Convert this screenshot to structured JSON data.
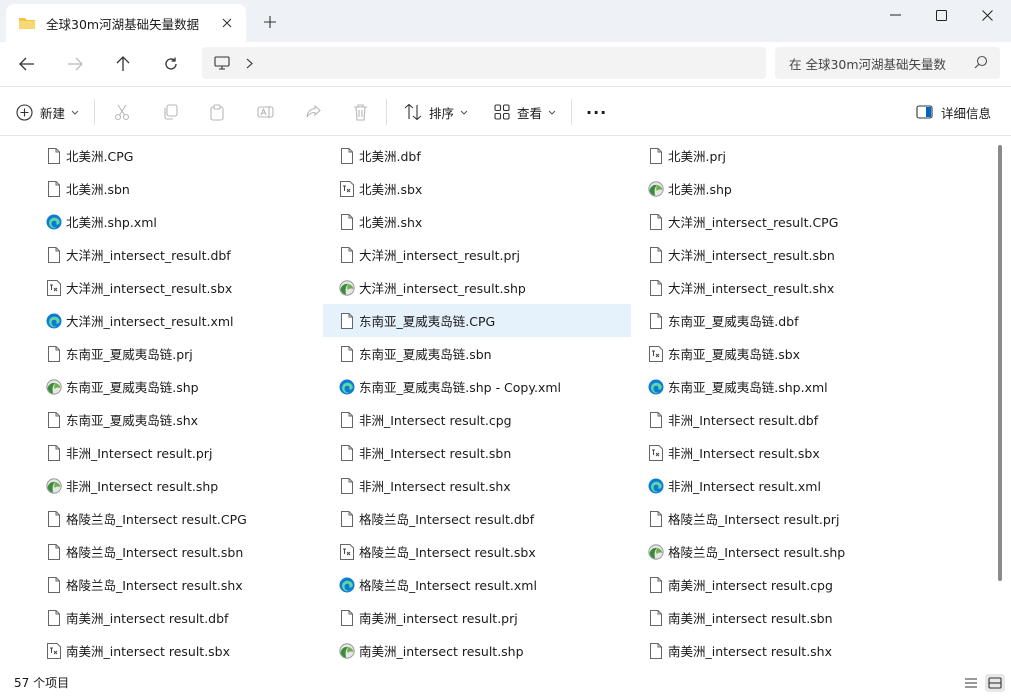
{
  "tab": {
    "title": "全球30m河湖基础矢量数据"
  },
  "window": {
    "minimize_icon": "minimize-icon",
    "maximize_icon": "maximize-icon",
    "close_icon": "close-icon"
  },
  "search": {
    "placeholder": "在 全球30m河湖基础矢量数"
  },
  "commands": {
    "new_label": "新建",
    "sort_label": "排序",
    "view_label": "查看",
    "more_label": "···",
    "details_label": "详细信息"
  },
  "files": [
    [
      {
        "name": "北美洲.CPG",
        "type": "doc"
      },
      {
        "name": "北美洲.dbf",
        "type": "doc"
      },
      {
        "name": "北美洲.prj",
        "type": "doc"
      }
    ],
    [
      {
        "name": "北美洲.sbn",
        "type": "doc"
      },
      {
        "name": "北美洲.sbx",
        "type": "sbx"
      },
      {
        "name": "北美洲.shp",
        "type": "shp"
      }
    ],
    [
      {
        "name": "北美洲.shp.xml",
        "type": "xml"
      },
      {
        "name": "北美洲.shx",
        "type": "doc"
      },
      {
        "name": "大洋洲_intersect_result.CPG",
        "type": "doc"
      }
    ],
    [
      {
        "name": "大洋洲_intersect_result.dbf",
        "type": "doc"
      },
      {
        "name": "大洋洲_intersect_result.prj",
        "type": "doc"
      },
      {
        "name": "大洋洲_intersect_result.sbn",
        "type": "doc"
      }
    ],
    [
      {
        "name": "大洋洲_intersect_result.sbx",
        "type": "sbx"
      },
      {
        "name": "大洋洲_intersect_result.shp",
        "type": "shp"
      },
      {
        "name": "大洋洲_intersect_result.shx",
        "type": "doc"
      }
    ],
    [
      {
        "name": "大洋洲_intersect_result.xml",
        "type": "xml"
      },
      {
        "name": "东南亚_夏威夷岛链.CPG",
        "type": "doc",
        "selected": true
      },
      {
        "name": "东南亚_夏威夷岛链.dbf",
        "type": "doc"
      }
    ],
    [
      {
        "name": "东南亚_夏威夷岛链.prj",
        "type": "doc"
      },
      {
        "name": "东南亚_夏威夷岛链.sbn",
        "type": "doc"
      },
      {
        "name": "东南亚_夏威夷岛链.sbx",
        "type": "sbx"
      }
    ],
    [
      {
        "name": "东南亚_夏威夷岛链.shp",
        "type": "shp"
      },
      {
        "name": "东南亚_夏威夷岛链.shp - Copy.xml",
        "type": "xml"
      },
      {
        "name": "东南亚_夏威夷岛链.shp.xml",
        "type": "xml"
      }
    ],
    [
      {
        "name": "东南亚_夏威夷岛链.shx",
        "type": "doc"
      },
      {
        "name": "非洲_Intersect result.cpg",
        "type": "doc"
      },
      {
        "name": "非洲_Intersect result.dbf",
        "type": "doc"
      }
    ],
    [
      {
        "name": "非洲_Intersect result.prj",
        "type": "doc"
      },
      {
        "name": "非洲_Intersect result.sbn",
        "type": "doc"
      },
      {
        "name": "非洲_Intersect result.sbx",
        "type": "sbx"
      }
    ],
    [
      {
        "name": "非洲_Intersect result.shp",
        "type": "shp"
      },
      {
        "name": "非洲_Intersect result.shx",
        "type": "doc"
      },
      {
        "name": "非洲_Intersect result.xml",
        "type": "xml"
      }
    ],
    [
      {
        "name": "格陵兰岛_Intersect result.CPG",
        "type": "doc"
      },
      {
        "name": "格陵兰岛_Intersect result.dbf",
        "type": "doc"
      },
      {
        "name": "格陵兰岛_Intersect result.prj",
        "type": "doc"
      }
    ],
    [
      {
        "name": "格陵兰岛_Intersect result.sbn",
        "type": "doc"
      },
      {
        "name": "格陵兰岛_Intersect result.sbx",
        "type": "sbx"
      },
      {
        "name": "格陵兰岛_Intersect result.shp",
        "type": "shp"
      }
    ],
    [
      {
        "name": "格陵兰岛_Intersect result.shx",
        "type": "doc"
      },
      {
        "name": "格陵兰岛_Intersect result.xml",
        "type": "xml"
      },
      {
        "name": "南美洲_intersect result.cpg",
        "type": "doc"
      }
    ],
    [
      {
        "name": "南美洲_intersect result.dbf",
        "type": "doc"
      },
      {
        "name": "南美洲_intersect result.prj",
        "type": "doc"
      },
      {
        "name": "南美洲_intersect result.sbn",
        "type": "doc"
      }
    ],
    [
      {
        "name": "南美洲_intersect result.sbx",
        "type": "sbx"
      },
      {
        "name": "南美洲_intersect result.shp",
        "type": "shp"
      },
      {
        "name": "南美洲_intersect result.shx",
        "type": "doc"
      }
    ]
  ],
  "status": {
    "item_count": "57 个项目"
  },
  "colors": {
    "accent": "#0067c0",
    "selection": "#e5f1fb",
    "folder": "#f4c542"
  }
}
